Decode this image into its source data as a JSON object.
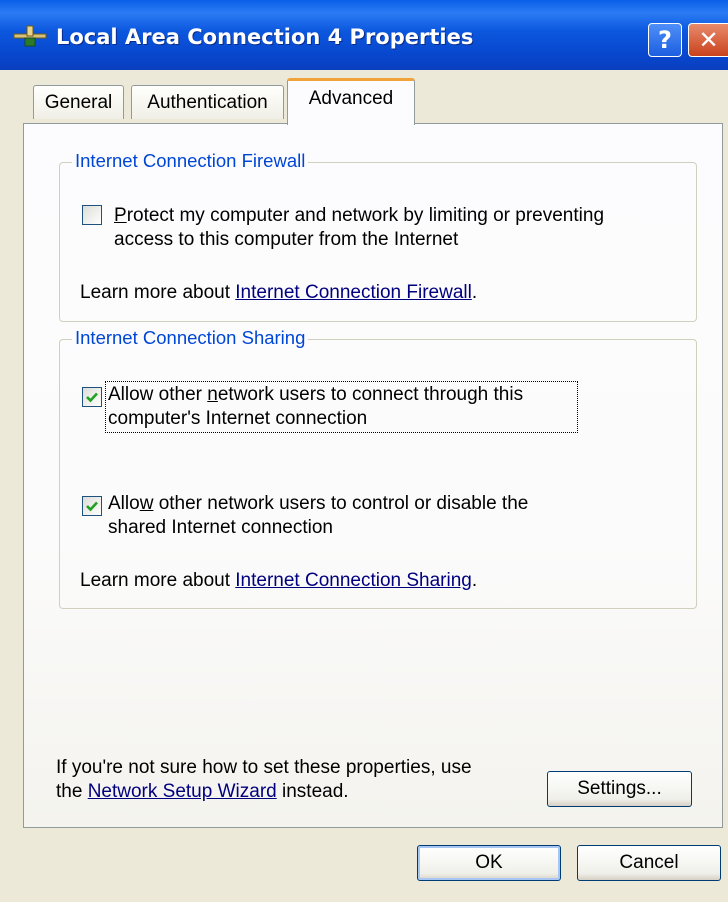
{
  "window": {
    "title": "Local Area Connection 4 Properties",
    "help_label": "?",
    "close_label": "✕",
    "icon": "network-connection-icon"
  },
  "tabs": [
    {
      "label": "General",
      "selected": false
    },
    {
      "label": "Authentication",
      "selected": false
    },
    {
      "label": "Advanced",
      "selected": true
    }
  ],
  "firewall": {
    "group_title": "Internet Connection Firewall",
    "checkbox_checked": false,
    "checkbox_access_key": "P",
    "checkbox_line1_rest": "rotect my computer and network by limiting or preventing",
    "checkbox_line2": "access to this computer from the Internet",
    "learn_prefix": "Learn more about ",
    "learn_link": "Internet Connection Firewall",
    "learn_suffix": "."
  },
  "sharing": {
    "group_title": "Internet Connection Sharing",
    "allow_connect_checked": true,
    "allow_connect_prefix": "Allow other ",
    "allow_connect_access_key": "n",
    "allow_connect_line1_rest": "etwork users to connect through this",
    "allow_connect_line2": "computer's Internet connection",
    "allow_control_checked": true,
    "allow_control_prefix": "Allo",
    "allow_control_access_key": "w",
    "allow_control_line1_rest": " other network users to control or disable the",
    "allow_control_line2": "shared Internet connection",
    "learn_prefix": "Learn more about ",
    "learn_link": "Internet Connection Sharing",
    "learn_suffix": "."
  },
  "footer": {
    "hint_line1": "If you're not sure how to set these properties, use",
    "hint_line2_prefix": "the ",
    "hint_link": "Network Setup Wizard",
    "hint_line2_suffix": " instead.",
    "settings_label": "Settings..."
  },
  "buttons": {
    "ok_label": "OK",
    "cancel_label": "Cancel"
  },
  "colors": {
    "titlebar": "#0a5fe8",
    "group_title": "#0046d5",
    "link": "#00007f",
    "tab_highlight": "#f0a33b",
    "checkmark": "#21a121"
  }
}
